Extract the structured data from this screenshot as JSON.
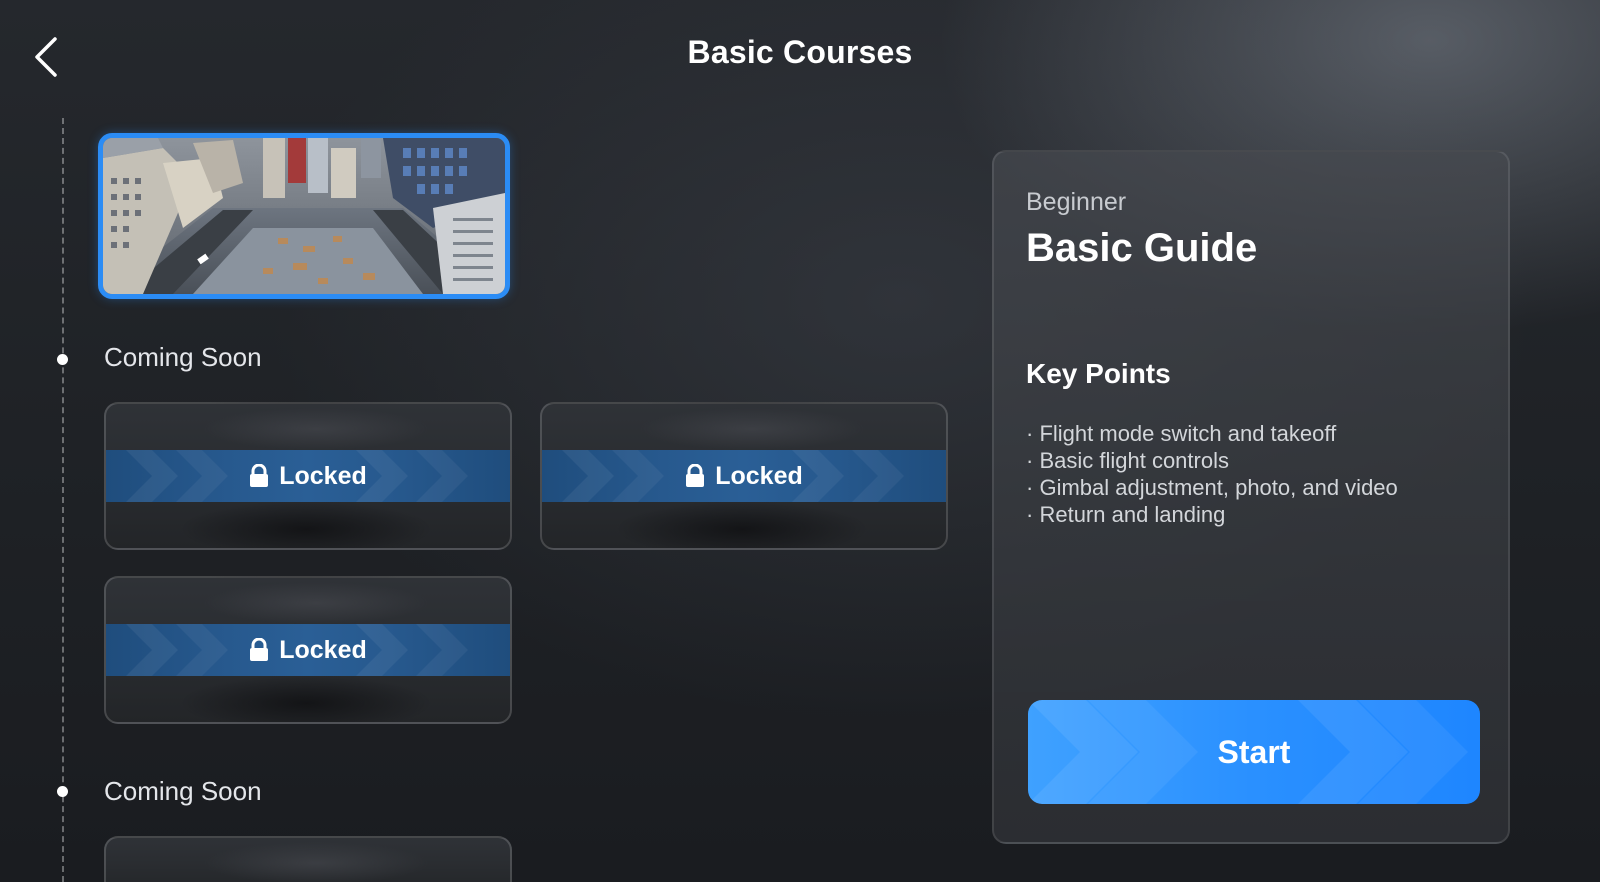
{
  "header": {
    "title": "Basic Courses",
    "back_icon": "chevron-left-icon"
  },
  "timeline": {
    "sections": [
      {
        "label": "Coming Soon"
      },
      {
        "label": "Coming Soon"
      }
    ]
  },
  "cards": {
    "locked_label": "Locked",
    "lock_icon": "lock-icon"
  },
  "panel": {
    "level": "Beginner",
    "title": "Basic Guide",
    "key_points_title": "Key Points",
    "points": [
      "Flight mode switch and takeoff",
      "Basic flight controls",
      "Gimbal adjustment, photo, and video",
      "Return and landing"
    ],
    "start_label": "Start"
  },
  "colors": {
    "accent": "#2b8cf5",
    "locked_band": "#27598e",
    "start_button": "#2a90ff"
  }
}
